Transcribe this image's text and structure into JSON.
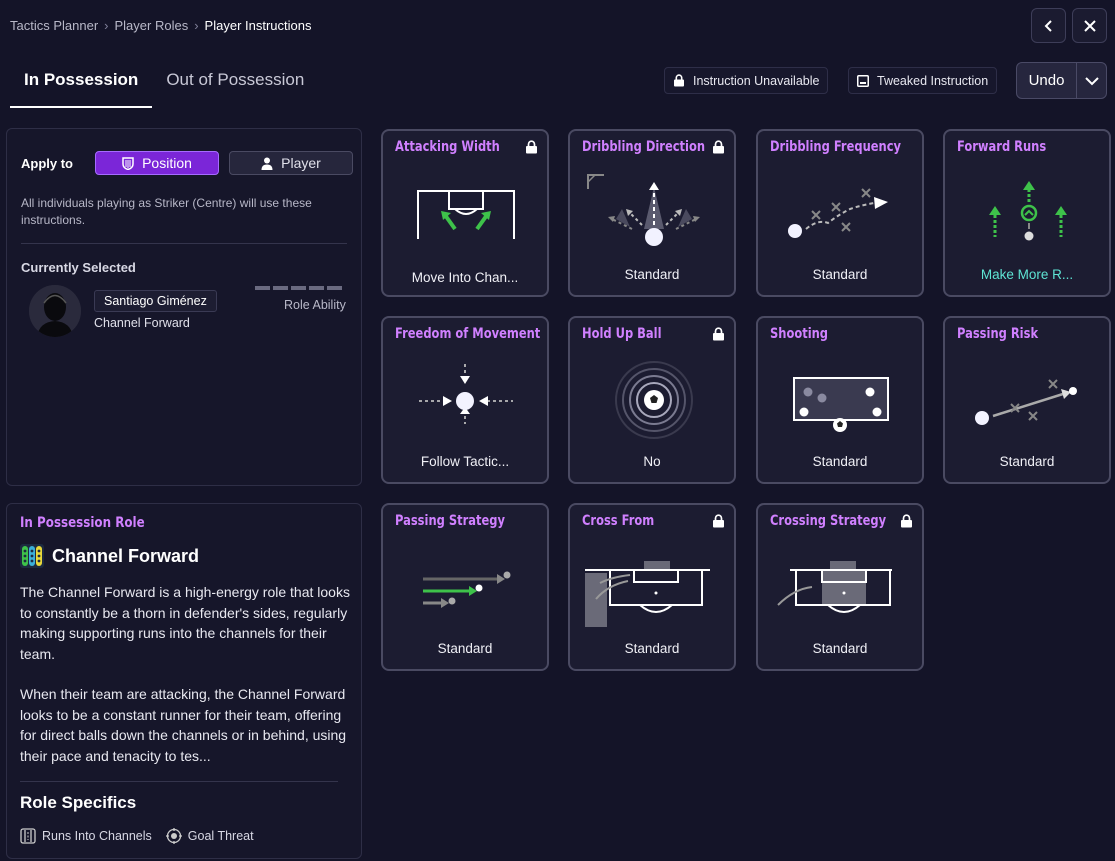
{
  "breadcrumb": [
    "Tactics Planner",
    "Player Roles",
    "Player Instructions"
  ],
  "tabs": [
    "In Possession",
    "Out of Possession"
  ],
  "legend": {
    "unavailable": "Instruction Unavailable",
    "tweaked": "Tweaked Instruction"
  },
  "undo_label": "Undo",
  "apply": {
    "label": "Apply to",
    "position": "Position",
    "player": "Player",
    "note": "All individuals playing as Striker (Centre) will use these instructions."
  },
  "current": {
    "title": "Currently Selected",
    "player_name": "Santiago Giménez",
    "player_role": "Channel Forward",
    "ability_label": "Role Ability"
  },
  "role": {
    "heading": "In Possession Role",
    "name": "Channel Forward",
    "desc1": "The Channel Forward is a high-energy role that looks to constantly be a thorn in defender's sides, regularly making supporting runs into the channels for their team.",
    "desc2": "When their team are attacking, the Channel Forward looks to be a constant runner for their team, offering for direct balls down the channels or in behind, using their pace and tenacity to tes...",
    "specifics_title": "Role Specifics",
    "specifics": [
      "Runs Into Channels",
      "Goal Threat"
    ]
  },
  "cards": [
    {
      "title": "Attacking Width",
      "value": "Move Into Chan...",
      "locked": true,
      "icon": "attacking-width-diagram"
    },
    {
      "title": "Dribbling Direction",
      "value": "Standard",
      "locked": true,
      "icon": "dribbling-direction-diagram"
    },
    {
      "title": "Dribbling Frequency",
      "value": "Standard",
      "locked": false,
      "icon": "dribbling-frequency-diagram"
    },
    {
      "title": "Forward Runs",
      "value": "Make More R...",
      "locked": false,
      "icon": "forward-runs-diagram",
      "highlight": true
    },
    {
      "title": "Freedom of Movement",
      "value": "Follow Tactic...",
      "locked": false,
      "icon": "freedom-of-movement-diagram"
    },
    {
      "title": "Hold Up Ball",
      "value": "No",
      "locked": true,
      "icon": "hold-up-ball-diagram"
    },
    {
      "title": "Shooting",
      "value": "Standard",
      "locked": false,
      "icon": "shooting-diagram"
    },
    {
      "title": "Passing Risk",
      "value": "Standard",
      "locked": false,
      "icon": "passing-risk-diagram"
    },
    {
      "title": "Passing Strategy",
      "value": "Standard",
      "locked": false,
      "icon": "passing-strategy-diagram"
    },
    {
      "title": "Cross From",
      "value": "Standard",
      "locked": true,
      "icon": "cross-from-diagram"
    },
    {
      "title": "Crossing Strategy",
      "value": "Standard",
      "locked": true,
      "icon": "crossing-strategy-diagram"
    }
  ],
  "colors": {
    "accent": "#d080ff",
    "position_btn": "#7b26d8",
    "highlight_value": "#5ee4d4",
    "green_arrow": "#3ec24a"
  }
}
